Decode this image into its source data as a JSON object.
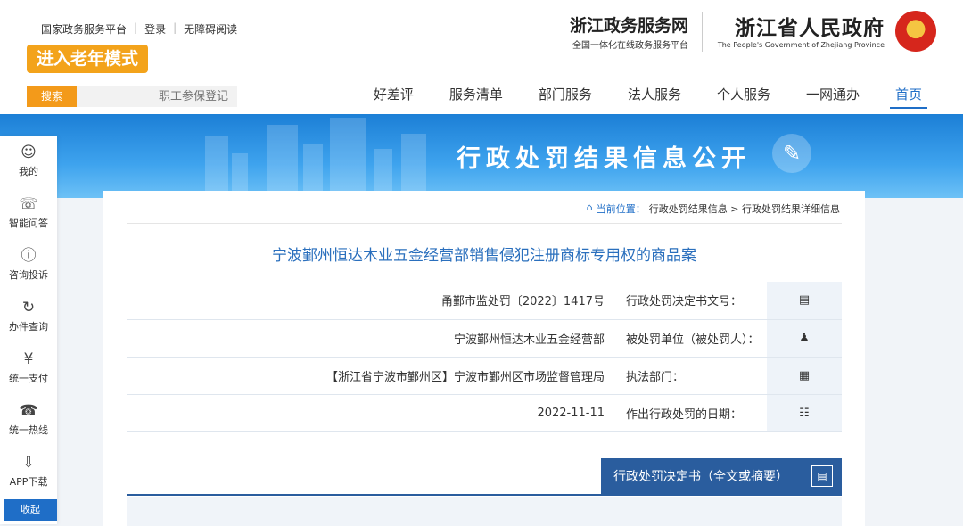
{
  "header": {
    "gov_title": "浙江省人民政府",
    "gov_en": "The People's Government of Zhejiang Province",
    "svc_title": "浙江政务服务网",
    "svc_sub": "全国一体化在线政务服务平台",
    "toplinks": [
      "国家政务服务平台",
      "登录",
      "无障碍阅读"
    ],
    "elder_mode": "进入老年模式",
    "search_button": "搜索",
    "search_placeholder": "职工参保登记"
  },
  "nav": [
    "首页",
    "一网通办",
    "个人服务",
    "法人服务",
    "部门服务",
    "服务清单",
    "好差评"
  ],
  "banner": {
    "title": "行政处罚结果信息公开"
  },
  "sidebar": {
    "items": [
      {
        "label": "我的",
        "icon": "user-icon"
      },
      {
        "label": "智能问答",
        "icon": "headset-icon"
      },
      {
        "label": "咨询投诉",
        "icon": "shield-icon"
      },
      {
        "label": "办件查询",
        "icon": "history-icon"
      },
      {
        "label": "统一支付",
        "icon": "yen-icon"
      },
      {
        "label": "统一热线",
        "icon": "phone-icon"
      },
      {
        "label": "APP下载",
        "icon": "download-icon"
      }
    ],
    "collapse": "收起"
  },
  "breadcrumb": {
    "label": "当前位置：",
    "path": "行政处罚结果信息 > 行政处罚结果详细信息"
  },
  "case_title": "宁波鄞州恒达木业五金经营部销售侵犯注册商标专用权的商品案",
  "info": [
    {
      "label": "行政处罚决定书文号：",
      "value": "甬鄞市监处罚〔2022〕1417号",
      "icon": "document-icon"
    },
    {
      "label": "被处罚单位（被处罚人）：",
      "value": "宁波鄞州恒达木业五金经营部",
      "icon": "person-icon"
    },
    {
      "label": "执法部门：",
      "value": "【浙江省宁波市鄞州区】宁波市鄞州区市场监督管理局",
      "icon": "building-icon"
    },
    {
      "label": "作出行政处罚的日期：",
      "value": "2022-11-11",
      "icon": "calendar-icon"
    }
  ],
  "decision_tab": "行政处罚决定书（全文或摘要）",
  "colors": {
    "primary": "#1f6ec7",
    "accent": "#f3a31b",
    "tab": "#2a5d9e"
  }
}
